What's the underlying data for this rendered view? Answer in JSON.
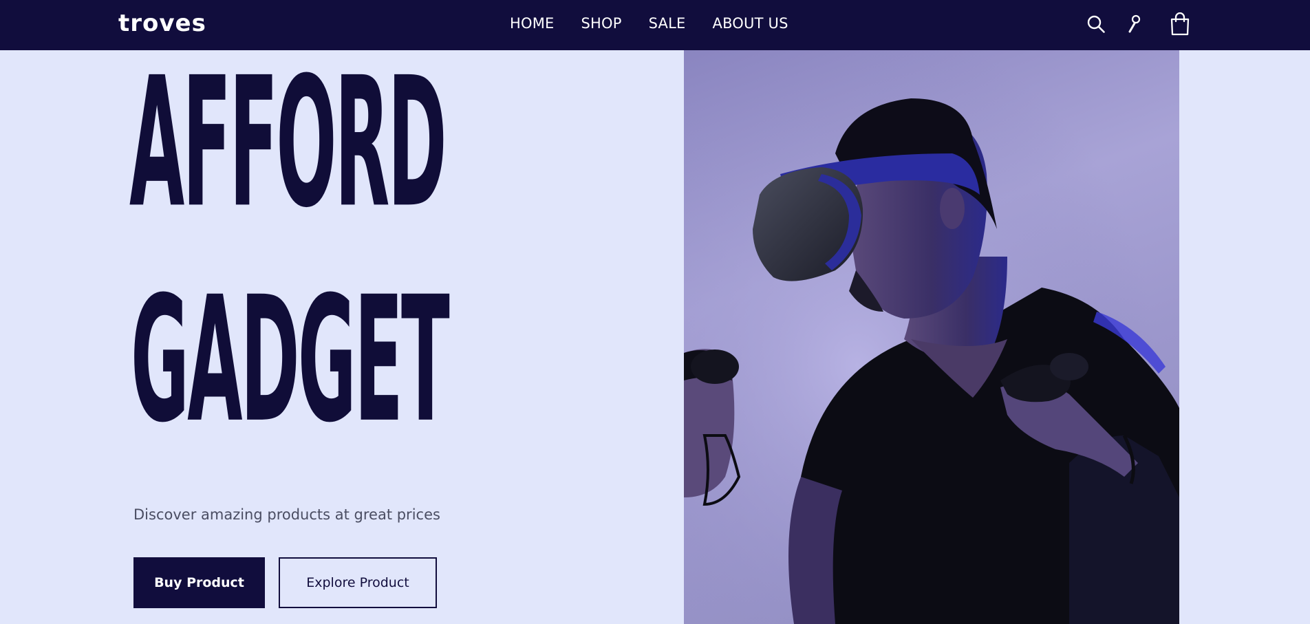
{
  "brand": {
    "logo_text": "troves"
  },
  "nav": {
    "items": [
      {
        "label": "HOME"
      },
      {
        "label": "SHOP"
      },
      {
        "label": "SALE"
      },
      {
        "label": "ABOUT US"
      }
    ],
    "icons": [
      "search-icon",
      "user-icon",
      "shopping-bag-icon"
    ]
  },
  "hero": {
    "title_line_1": "AFFORD",
    "title_line_2": "GADGET",
    "subtitle": "Discover amazing products at great prices",
    "primary_button": "Buy Product",
    "secondary_button": "Explore Product",
    "image": "man-wearing-vr-headset-with-controllers"
  },
  "colors": {
    "navbar_bg": "#110d3d",
    "page_bg": "#e1e6fb",
    "title": "#100d38",
    "accent_blue": "#3a3ae0"
  }
}
